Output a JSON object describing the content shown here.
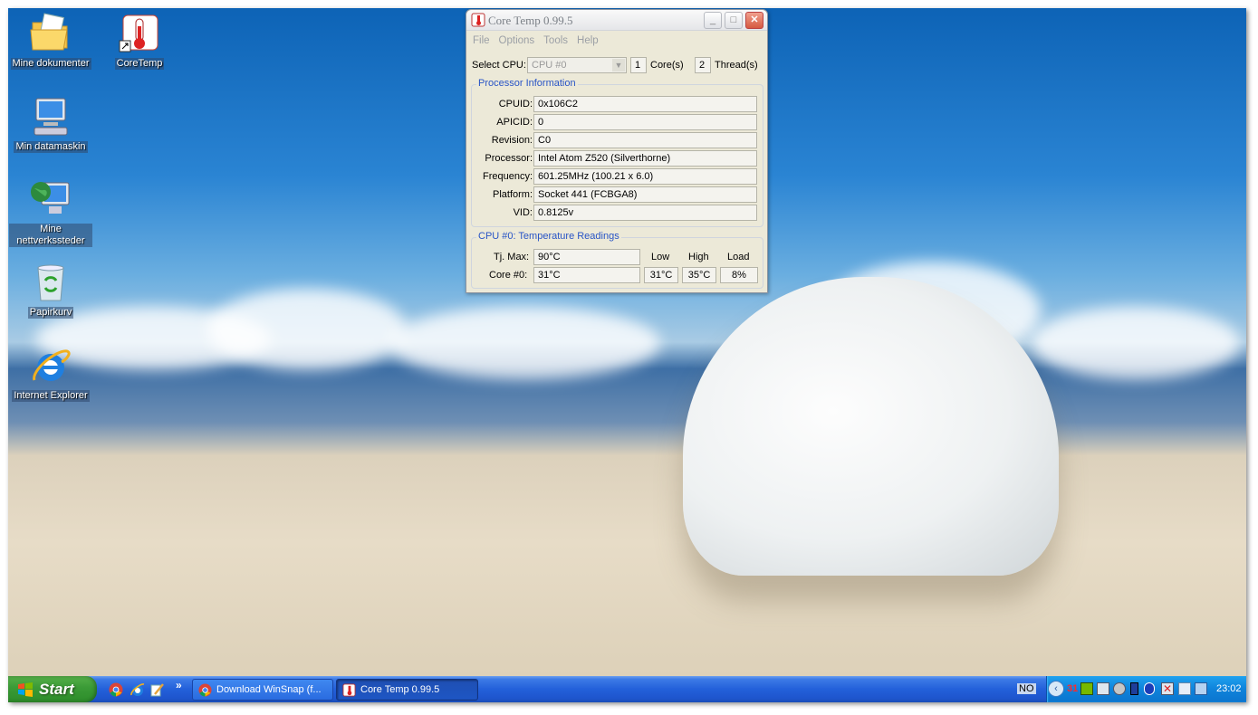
{
  "desktop": {
    "icons": [
      {
        "label": "Mine dokumenter",
        "icon": "folder-documents-icon"
      },
      {
        "label": "CoreTemp",
        "icon": "thermometer-shortcut-icon"
      },
      {
        "label": "Min datamaskin",
        "icon": "my-computer-icon"
      },
      {
        "label": "Mine nettverkssteder",
        "icon": "network-places-icon"
      },
      {
        "label": "Papirkurv",
        "icon": "recycle-bin-icon"
      },
      {
        "label": "Internet Explorer",
        "icon": "internet-explorer-icon"
      }
    ]
  },
  "window": {
    "title": "Core Temp 0.99.5",
    "controls": {
      "minimize": "_",
      "maximize": "□",
      "close": "✕"
    },
    "menu": [
      "File",
      "Options",
      "Tools",
      "Help"
    ],
    "select_cpu_label": "Select CPU:",
    "select_cpu_value": "CPU #0",
    "cores_count": "1",
    "cores_label": "Core(s)",
    "threads_count": "2",
    "threads_label": "Thread(s)",
    "processor_info": {
      "title": "Processor Information",
      "rows": [
        {
          "label": "CPUID:",
          "value": "0x106C2"
        },
        {
          "label": "APICID:",
          "value": "0"
        },
        {
          "label": "Revision:",
          "value": "C0"
        },
        {
          "label": "Processor:",
          "value": "Intel Atom Z520 (Silverthorne)"
        },
        {
          "label": "Frequency:",
          "value": "601.25MHz (100.21 x 6.0)"
        },
        {
          "label": "Platform:",
          "value": "Socket 441 (FCBGA8)"
        },
        {
          "label": "VID:",
          "value": "0.8125v"
        }
      ]
    },
    "temperature": {
      "title": "CPU #0: Temperature Readings",
      "tjmax_label": "Tj. Max:",
      "tjmax_value": "90°C",
      "headers": {
        "low": "Low",
        "high": "High",
        "load": "Load"
      },
      "core_label": "Core #0:",
      "core_value": "31°C",
      "low": "31°C",
      "high": "35°C",
      "load": "8%"
    }
  },
  "taskbar": {
    "start_label": "Start",
    "quicklaunch": [
      "chrome-icon",
      "internet-explorer-icon",
      "edit-icon"
    ],
    "chevron": "»",
    "buttons": [
      {
        "label": "Download WinSnap (f...",
        "icon": "chrome-icon"
      },
      {
        "label": "Core Temp 0.99.5",
        "icon": "thermometer-icon"
      }
    ],
    "language": "NO",
    "tray_number": "31",
    "clock": "23:02"
  },
  "colors": {
    "taskbar_blue": "#245edb",
    "start_green": "#3a9a36",
    "tray_blue": "#0f83db",
    "window_face": "#ece9d8",
    "group_title": "#2854c6"
  }
}
